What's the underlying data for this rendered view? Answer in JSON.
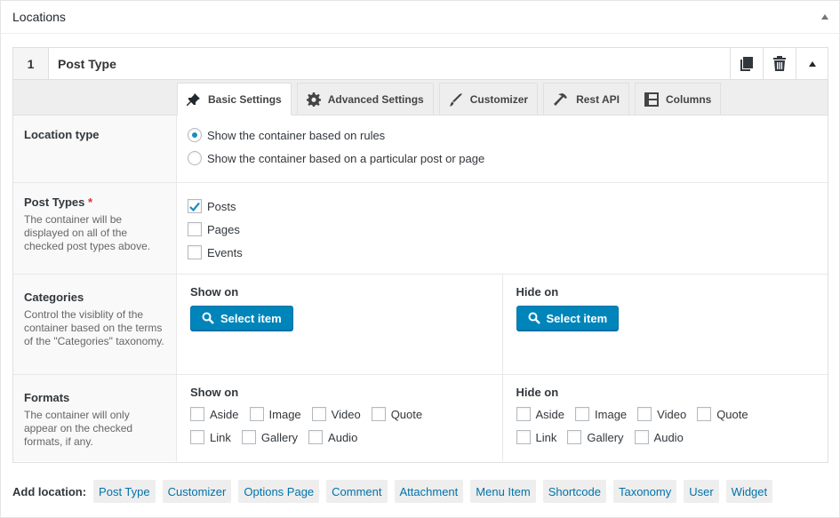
{
  "postbox": {
    "title": "Locations"
  },
  "group": {
    "number": "1",
    "title": "Post Type",
    "actions": [
      "duplicate-icon",
      "trash-icon",
      "collapse-icon"
    ]
  },
  "tabs": [
    {
      "label": "Basic Settings",
      "icon": "pin-icon",
      "active": true
    },
    {
      "label": "Advanced Settings",
      "icon": "gear-icon",
      "active": false
    },
    {
      "label": "Customizer",
      "icon": "brush-icon",
      "active": false
    },
    {
      "label": "Rest API",
      "icon": "hammer-icon",
      "active": false
    },
    {
      "label": "Columns",
      "icon": "columns-icon",
      "active": false
    }
  ],
  "location_type": {
    "label": "Location type",
    "options": [
      {
        "label": "Show the container based on rules",
        "selected": true
      },
      {
        "label": "Show the container based on a particular post or page",
        "selected": false
      }
    ]
  },
  "post_types": {
    "label": "Post Types",
    "required_mark": "*",
    "description": "The container will be displayed on all of the checked post types above.",
    "options": [
      {
        "label": "Posts",
        "checked": true
      },
      {
        "label": "Pages",
        "checked": false
      },
      {
        "label": "Events",
        "checked": false
      }
    ]
  },
  "categories": {
    "label": "Categories",
    "description": "Control the visiblity of the container based on the terms of the \"Categories\" taxonomy.",
    "show_on": {
      "title": "Show on",
      "button": "Select item"
    },
    "hide_on": {
      "title": "Hide on",
      "button": "Select item"
    }
  },
  "formats": {
    "label": "Formats",
    "description": "The container will only appear on the checked formats, if any.",
    "show_on": {
      "title": "Show on",
      "options": [
        "Aside",
        "Image",
        "Video",
        "Quote",
        "Link",
        "Gallery",
        "Audio"
      ]
    },
    "hide_on": {
      "title": "Hide on",
      "options": [
        "Aside",
        "Image",
        "Video",
        "Quote",
        "Link",
        "Gallery",
        "Audio"
      ]
    }
  },
  "add_location": {
    "label": "Add location:",
    "buttons": [
      "Post Type",
      "Customizer",
      "Options Page",
      "Comment",
      "Attachment",
      "Menu Item",
      "Shortcode",
      "Taxonomy",
      "User",
      "Widget"
    ]
  },
  "colors": {
    "primary_button": "#0085ba",
    "link": "#0073aa",
    "required": "#dc3232",
    "check": "#1e8cbe"
  }
}
